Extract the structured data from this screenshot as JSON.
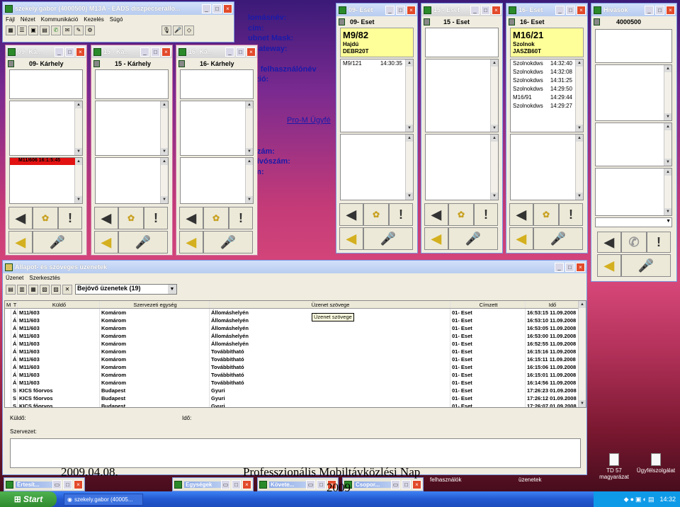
{
  "bg_text": {
    "lines": [
      "lomásnév:",
      "cím:",
      "ubnet Mask:",
      "t Gateway:",
      "n:",
      "ws felhasználónév",
      "erzió:",
      "",
      "",
      "",
      "Pro-M Ügyfé",
      "",
      "",
      "nszám:",
      "í hívószám:",
      "cím:"
    ]
  },
  "main_win": {
    "title": "szekely.gabor (4000500) M13A - EADS diszpécserállo...",
    "menu": [
      "Fájl",
      "Nézet",
      "Kommunikáció",
      "Kezelés",
      "Súgó"
    ]
  },
  "small_wins": [
    {
      "title": "09- Ká...",
      "header": "09- Kárhely",
      "red_row": "M11/606    16:1:5:45"
    },
    {
      "title": "15 - Ká...",
      "header": "15 - Kárhely"
    },
    {
      "title": "16- Ká...",
      "header": "16- Kárhely"
    }
  ],
  "eset_wins": [
    {
      "title": "09- Eset",
      "header": "09- Eset",
      "case_id": "M9/82",
      "line1": "Hajdú",
      "line2": "DEBR20T",
      "list": [
        {
          "a": "M9/121",
          "b": "14:30:35"
        }
      ]
    },
    {
      "title": "15 - Eset",
      "header": "15 - Eset"
    },
    {
      "title": "16- Eset",
      "header": "16- Eset",
      "case_id": "M16/21",
      "line1": "Szolnok",
      "line2": "JASZB60T",
      "list": [
        {
          "a": "Szolnokdws",
          "b": "14:32:40"
        },
        {
          "a": "Szolnokdws",
          "b": "14:32:08"
        },
        {
          "a": "Szolnokdws",
          "b": "14:31:25"
        },
        {
          "a": "Szolnokdws",
          "b": "14:29:50"
        },
        {
          "a": "M16/91",
          "b": "14:29:44"
        },
        {
          "a": "Szolnokdws",
          "b": "14:29:27"
        }
      ]
    }
  ],
  "hivasok": {
    "title": "Hívások",
    "header": "4000500"
  },
  "msg_win": {
    "title": "Állapot- és szöveges üzenetek",
    "menu": [
      "Üzenet",
      "Szerkesztés"
    ],
    "folder": "Bejövő üzenetek (19)",
    "columns": [
      "M",
      "T",
      "Küldő",
      "Szervezeti egység",
      "Üzenet szövege",
      "Címzett",
      "Idő"
    ],
    "tooltip": "Üzenet szövege",
    "rows": [
      [
        "",
        "Á",
        "M11/603",
        "Komárom",
        "Állomáshelyén",
        "01- Eset",
        "16:53:15 11.09.2008"
      ],
      [
        "",
        "Á",
        "M11/603",
        "Komárom",
        "Állomáshelyén",
        "01- Eset",
        "16:53:10 11.09.2008"
      ],
      [
        "",
        "Á",
        "M11/603",
        "Komárom",
        "Állomáshelyén",
        "01- Eset",
        "16:53:05 11.09.2008"
      ],
      [
        "",
        "Á",
        "M11/603",
        "Komárom",
        "Állomáshelyén",
        "01- Eset",
        "16:53:00 11.09.2008"
      ],
      [
        "",
        "Á",
        "M11/603",
        "Komárom",
        "Állomáshelyén",
        "01- Eset",
        "16:52:55 11.09.2008"
      ],
      [
        "",
        "Á",
        "M11/603",
        "Komárom",
        "Továbbítható",
        "01- Eset",
        "16:15:16 11.09.2008"
      ],
      [
        "",
        "Á",
        "M11/603",
        "Komárom",
        "Továbbítható",
        "01- Eset",
        "16:15:11 11.09.2008"
      ],
      [
        "",
        "Á",
        "M11/603",
        "Komárom",
        "Továbbítható",
        "01- Eset",
        "16:15:06 11.09.2008"
      ],
      [
        "",
        "Á",
        "M11/603",
        "Komárom",
        "Továbbítható",
        "01- Eset",
        "16:15:01 11.09.2008"
      ],
      [
        "",
        "Á",
        "M11/603",
        "Komárom",
        "Továbbítható",
        "01- Eset",
        "16:14:56 11.09.2008"
      ],
      [
        "",
        "S",
        "KICS főorvos",
        "Budapest",
        "Gyuri",
        "01- Eset",
        "17:26:23 01.09.2008"
      ],
      [
        "",
        "S",
        "KICS főorvos",
        "Budapest",
        "Gyuri",
        "01- Eset",
        "17:26:12 01.09.2008"
      ],
      [
        "",
        "S",
        "KICS főorvos",
        "Budapest",
        "Gyuri",
        "01- Eset",
        "17:26:07 01.09.2008"
      ]
    ],
    "kuldo_label": "Küldő:",
    "ido_label": "Idő:",
    "szervezet_label": "Szervezet:"
  },
  "minimized": [
    {
      "title": "Értesít..."
    },
    {
      "title": "Egységek"
    },
    {
      "title": "Követe..."
    },
    {
      "title": "Csopor..."
    }
  ],
  "desktop_labels": {
    "felhasznalok": "felhasználók",
    "uzenetek": "üzenetek"
  },
  "desktop_icons": [
    {
      "label": "TD 57 magyarázat"
    },
    {
      "label": "Ügyfélszolgálat"
    }
  ],
  "taskbar": {
    "start": "Start",
    "item": "szekely.gabor (40005...",
    "clock": "14:32"
  },
  "overlay": {
    "date": "2009.04.08.",
    "title": "Professzionális Mobiltávközlési Nap",
    "year": "2009"
  },
  "colors": {
    "title_blue": "#b8ccf0",
    "alert_red": "#e31212",
    "case_yellow": "#ffff99"
  }
}
